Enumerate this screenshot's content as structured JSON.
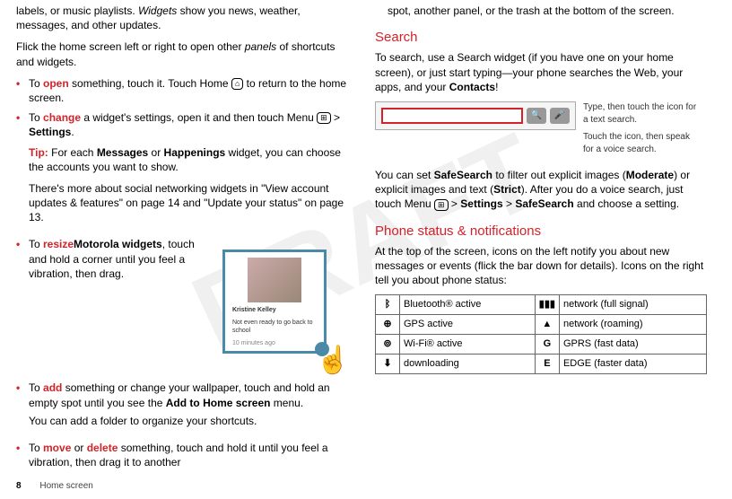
{
  "watermark": "DRAFT",
  "left": {
    "intro1a": "labels, or music playlists. ",
    "intro1_em": "Widgets",
    "intro1b": " show you news, weather, messages, and other updates.",
    "intro2a": "Flick the home screen left or right to open other ",
    "intro2_em": "panels",
    "intro2b": " of shortcuts and widgets.",
    "b1_pre": "To ",
    "b1_kw": "open",
    "b1_mid": " something, touch it. Touch Home ",
    "b1_post": " to return to the home screen.",
    "b2_pre": "To ",
    "b2_kw": "change",
    "b2_mid": " a widget's settings, open it and then touch Menu ",
    "b2_gt": " > ",
    "b2_set": "Settings",
    "b2_post": ".",
    "tip_label": "Tip:",
    "tip_a": " For each ",
    "tip_b1": "Messages",
    "tip_mid": " or ",
    "tip_b2": "Happenings",
    "tip_post": " widget, you can choose the accounts you want to show.",
    "social": "There's more about social networking widgets in \"View account updates & features\" on page 14 and \"Update your status\" on page 13.",
    "b3_pre": "To ",
    "b3_kw": "resize",
    "b3_bold": "Motorola widgets",
    "b3_post": ", touch and hold a corner until you feel a vibration, then drag.",
    "b4_pre": "To ",
    "b4_kw": "add",
    "b4_mid": " something or change your wallpaper, touch and hold an empty spot until you see the ",
    "b4_bold": "Add to Home screen",
    "b4_post": " menu.",
    "folder": "You can add a folder to organize your shortcuts.",
    "b5_pre": "To ",
    "b5_kw1": "move",
    "b5_or": " or ",
    "b5_kw2": "delete",
    "b5_post": " something, touch and hold it until you feel a vibration, then drag it to another",
    "widget_name": "Kristine Kelley",
    "widget_status": "Not even ready to go back to school",
    "widget_time": "10 minutes ago"
  },
  "right": {
    "cont": "spot, another panel, or the trash at the bottom of the screen.",
    "search_h": "Search",
    "search_p_a": "To search, use a Search widget (if you have one on your home screen), or just start typing—your phone searches the Web, your apps, and your ",
    "search_p_b": "Contacts",
    "search_p_c": "!",
    "annot1": "Type, then touch the icon for a text search.",
    "annot2": "Touch the icon, then speak for a voice search.",
    "safe_a": "You can set ",
    "safe_b1": "SafeSearch",
    "safe_mid1": " to filter out explicit images (",
    "safe_b2": "Moderate",
    "safe_mid2": ") or explicit images and text (",
    "safe_b3": "Strict",
    "safe_mid3": "). After you do a voice search, just touch Menu ",
    "safe_gt": " > ",
    "safe_b4": "Settings",
    "safe_gt2": " > ",
    "safe_b5": "SafeSearch",
    "safe_post": " and choose a setting.",
    "status_h": "Phone status & notifications",
    "status_p": "At the top of the screen, icons on the left notify you about new messages or events (flick the bar down for details). Icons on the right tell you about phone status:",
    "tbl": {
      "r1c1": "Bluetooth® active",
      "r1c2": "network (full signal)",
      "r2c1": "GPS active",
      "r2c2": "network (roaming)",
      "r3c1": "Wi-Fi® active",
      "r3c2": "GPRS (fast data)",
      "r4c1": "downloading",
      "r4c2": "EDGE (faster data)",
      "i3": "G",
      "i4": "E"
    }
  },
  "footer": {
    "page": "8",
    "section": "Home screen"
  },
  "icons": {
    "home": "⌂",
    "menu": "⊞",
    "bt": "ᛒ",
    "gps": "⊕",
    "wifi": "⊚",
    "dl": "⬇",
    "sig": "▮▮▮",
    "roam": "▲",
    "search": "🔍",
    "mic": "🎤"
  }
}
